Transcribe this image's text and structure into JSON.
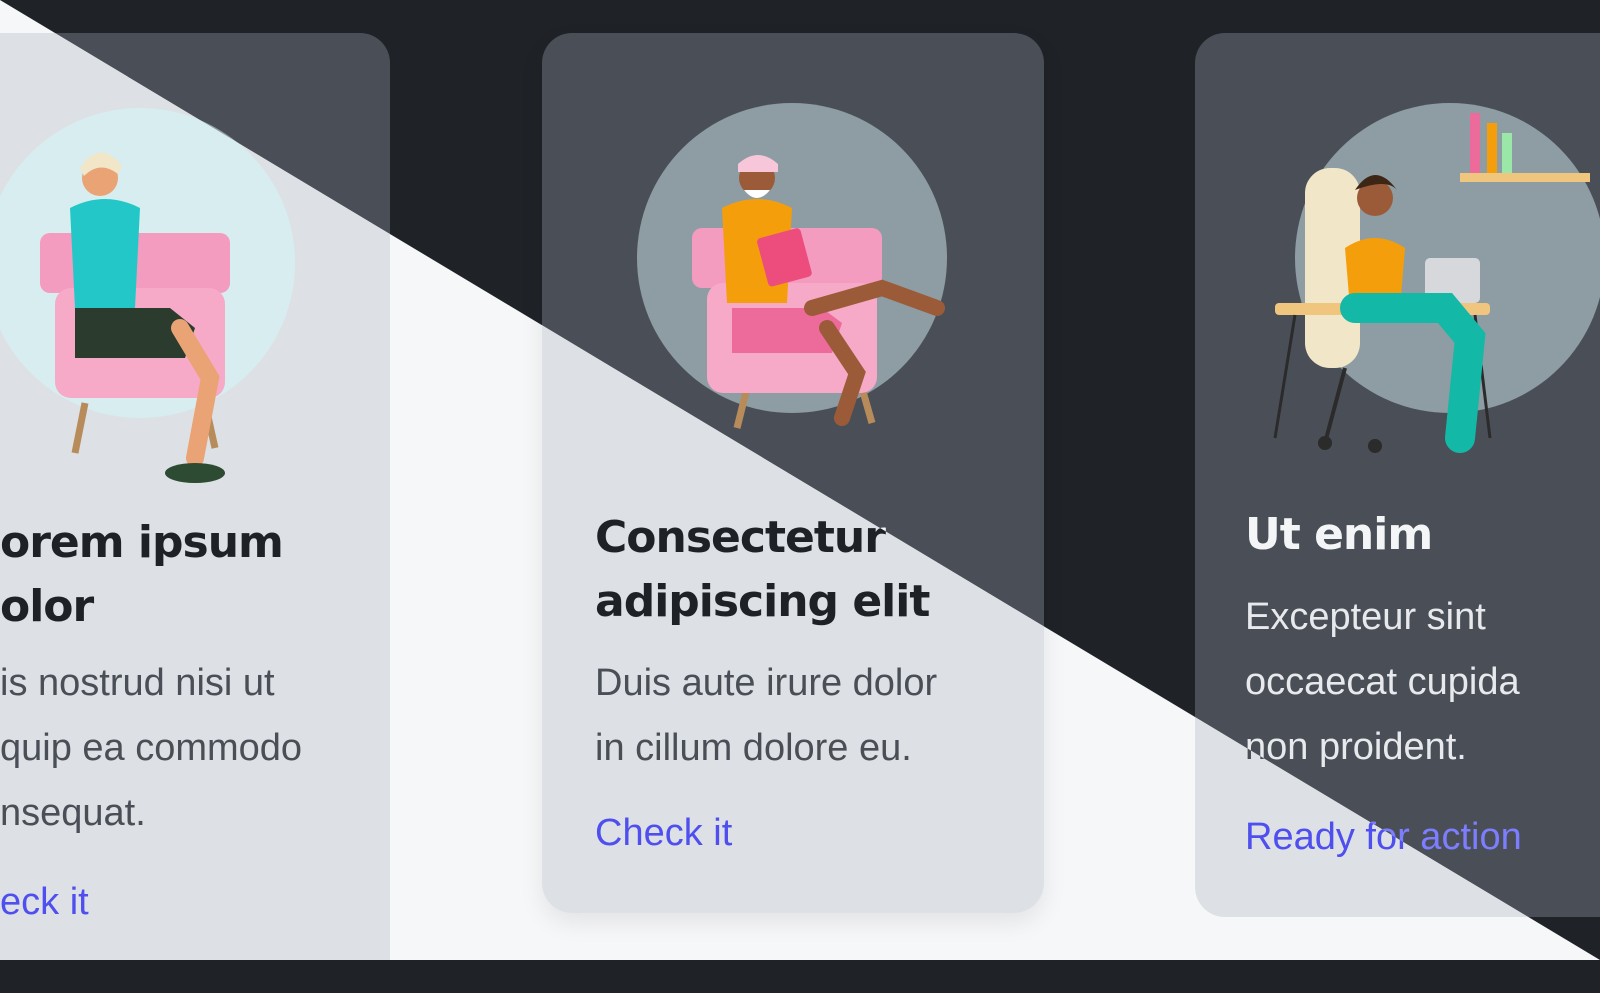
{
  "cards": [
    {
      "title_line1": "orem ipsum",
      "title_line2": "olor",
      "desc_line1": "is nostrud nisi ut",
      "desc_line2": "quip ea commodo",
      "desc_line3": "nsequat.",
      "link": "eck it",
      "illustration": "man-sitting-in-armchair"
    },
    {
      "title_line1": "Consectetur",
      "title_line2": "adipiscing elit",
      "desc_line1": "Duis aute irure dolor",
      "desc_line2": "in cillum dolore eu.",
      "link": "Check it",
      "illustration": "man-reading-in-armchair"
    },
    {
      "title_line1": "Ut enim",
      "desc_line1": "Excepteur sint",
      "desc_line2": "occaecat cupida",
      "desc_line3": "non proident.",
      "link": "Ready for action",
      "illustration": "woman-working-at-laptop"
    }
  ],
  "colors": {
    "dark_background": "#1f2227",
    "light_background": "#f6f7f9",
    "dark_card": "#4a4f57",
    "light_card": "#dde0e4",
    "link_light": "#4f4ff0",
    "link_dark": "#7d7dff"
  }
}
